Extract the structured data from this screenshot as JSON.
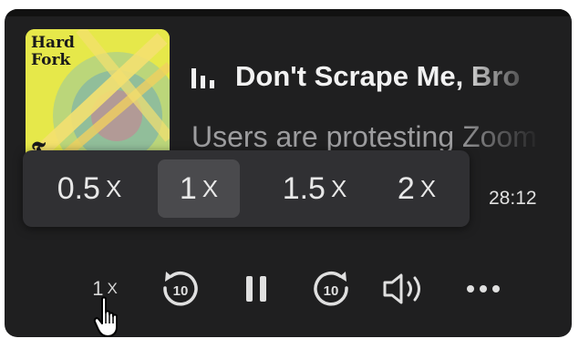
{
  "episode": {
    "cover_title": "Hard\nFork",
    "cover_mark": "𝕿",
    "title": "Don't Scrape Me, Bro",
    "subtitle": "Users are protesting Zoom"
  },
  "speed_menu": {
    "options": [
      {
        "value": "0.5",
        "unit": "X"
      },
      {
        "value": "1",
        "unit": "X",
        "selected": true
      },
      {
        "value": "1.5",
        "unit": "X"
      },
      {
        "value": "2",
        "unit": "X"
      }
    ]
  },
  "playback": {
    "time_remaining": "28:12",
    "rate_value": "1",
    "rate_unit": "X",
    "skip_back_seconds": "10",
    "skip_forward_seconds": "10"
  },
  "icons": {
    "playing": "bars-icon",
    "skip_back": "rewind-10-icon",
    "pause": "pause-icon",
    "skip_forward": "forward-10-icon",
    "volume": "speaker-icon",
    "more": "more-dots-icon",
    "cursor": "hand-pointer-icon"
  },
  "colors": {
    "panel": "#1f1f20",
    "popup": "#303033",
    "selected": "#4a4a4d",
    "text": "#f2f2f2",
    "subtext": "#9d9d9f",
    "cover": "#e6e84a"
  }
}
